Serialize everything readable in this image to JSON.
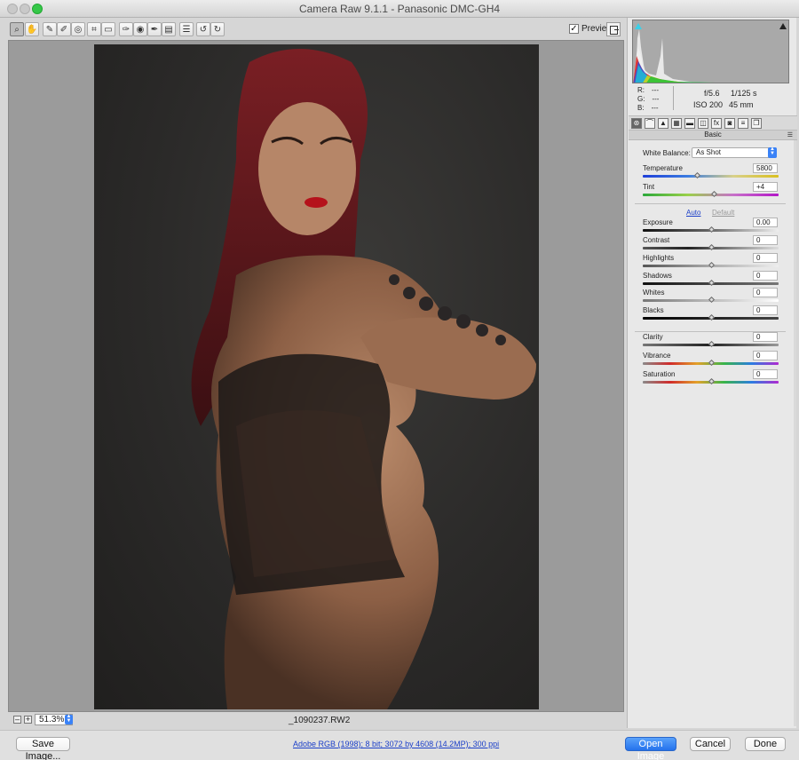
{
  "window": {
    "title": "Camera Raw 9.1.1  -  Panasonic DMC-GH4"
  },
  "toolbar": {
    "tools": [
      {
        "name": "zoom-tool",
        "icon": "magnifier-icon",
        "glyph": "⌕"
      },
      {
        "name": "hand-tool",
        "icon": "hand-icon",
        "glyph": "✋"
      },
      {
        "name": "white-balance-tool",
        "icon": "eyedropper-icon",
        "glyph": "✎"
      },
      {
        "name": "color-sampler-tool",
        "icon": "color-sampler-icon",
        "glyph": "✐"
      },
      {
        "name": "targeted-adjustment-tool",
        "icon": "target-icon",
        "glyph": "◎"
      },
      {
        "name": "crop-tool",
        "icon": "crop-icon",
        "glyph": "⌗"
      },
      {
        "name": "straighten-tool",
        "icon": "straighten-icon",
        "glyph": "▭"
      },
      {
        "name": "spot-removal-tool",
        "icon": "brush-spot-icon",
        "glyph": "✑"
      },
      {
        "name": "red-eye-tool",
        "icon": "eye-icon",
        "glyph": "◉"
      },
      {
        "name": "adjustment-brush-tool",
        "icon": "brush-icon",
        "glyph": "✒"
      },
      {
        "name": "graduated-filter-tool",
        "icon": "graduated-filter-icon",
        "glyph": "▤"
      },
      {
        "name": "preferences-tool",
        "icon": "list-icon",
        "glyph": "☰"
      },
      {
        "name": "rotate-left-tool",
        "icon": "rotate-ccw-icon",
        "glyph": "↺"
      },
      {
        "name": "rotate-right-tool",
        "icon": "rotate-cw-icon",
        "glyph": "↻"
      }
    ],
    "preview_label": "Preview",
    "preview_checked": "✓"
  },
  "status": {
    "zoom_value": "51.3%",
    "zoom_minus": "–",
    "zoom_plus": "+",
    "filename": "_1090237.RW2"
  },
  "bottom": {
    "save_label": "Save Image...",
    "workflow_text": "Adobe RGB (1998); 8 bit; 3072 by 4608 (14.2MP); 300 ppi",
    "open_label": "Open Image",
    "cancel_label": "Cancel",
    "done_label": "Done"
  },
  "readouts": {
    "r_label": "R:",
    "r_value": "---",
    "g_label": "G:",
    "g_value": "---",
    "b_label": "B:",
    "b_value": "---",
    "aperture": "f/5.6",
    "shutter": "1/125 s",
    "iso": "ISO 200",
    "focal": "45 mm"
  },
  "panel_tabs": [
    {
      "name": "basic",
      "icon": "aperture-icon",
      "glyph": "⊛",
      "active": true
    },
    {
      "name": "tone-curve",
      "icon": "curve-icon",
      "glyph": "⌒"
    },
    {
      "name": "detail",
      "icon": "triangle-icon",
      "glyph": "▲"
    },
    {
      "name": "hsl",
      "icon": "hsl-icon",
      "glyph": "▦"
    },
    {
      "name": "split-toning",
      "icon": "split-icon",
      "glyph": "▬"
    },
    {
      "name": "lens-corrections",
      "icon": "lens-icon",
      "glyph": "◫"
    },
    {
      "name": "effects",
      "icon": "fx-icon",
      "glyph": "fx"
    },
    {
      "name": "camera-calibration",
      "icon": "camera-icon",
      "glyph": "◙"
    },
    {
      "name": "presets",
      "icon": "presets-icon",
      "glyph": "≡"
    },
    {
      "name": "snapshots",
      "icon": "snapshot-icon",
      "glyph": "❐"
    }
  ],
  "basic": {
    "section_title": "Basic",
    "menu_glyph": "☰",
    "white_balance_label": "White Balance:",
    "white_balance_value": "As Shot",
    "auto_label": "Auto",
    "default_label": "Default",
    "sliders": [
      {
        "name": "temperature",
        "label": "Temperature",
        "value": "5800",
        "level": 0.4,
        "track": "temperature"
      },
      {
        "name": "tint",
        "label": "Tint",
        "value": "+4",
        "level": 0.52,
        "track": "tint"
      },
      {
        "name": "exposure",
        "label": "Exposure",
        "value": "0.00",
        "level": 0.5,
        "track": "exposure"
      },
      {
        "name": "contrast",
        "label": "Contrast",
        "value": "0",
        "level": 0.5,
        "track": "contrast"
      },
      {
        "name": "highlights",
        "label": "Highlights",
        "value": "0",
        "level": 0.5,
        "track": "highlights"
      },
      {
        "name": "shadows",
        "label": "Shadows",
        "value": "0",
        "level": 0.5,
        "track": "shadows"
      },
      {
        "name": "whites",
        "label": "Whites",
        "value": "0",
        "level": 0.5,
        "track": "whites"
      },
      {
        "name": "blacks",
        "label": "Blacks",
        "value": "0",
        "level": 0.5,
        "track": "blacks"
      },
      {
        "name": "clarity",
        "label": "Clarity",
        "value": "0",
        "level": 0.5,
        "track": "clarity"
      },
      {
        "name": "vibrance",
        "label": "Vibrance",
        "value": "0",
        "level": 0.5,
        "track": "vibrance"
      },
      {
        "name": "saturation",
        "label": "Saturation",
        "value": "0",
        "level": 0.5,
        "track": "saturation"
      }
    ]
  },
  "colors": {
    "accent": "#2f7bf0",
    "link": "#1b3fc8",
    "canvas_bg": "#9b9b9b",
    "photo_bg": "#2b2a29"
  }
}
